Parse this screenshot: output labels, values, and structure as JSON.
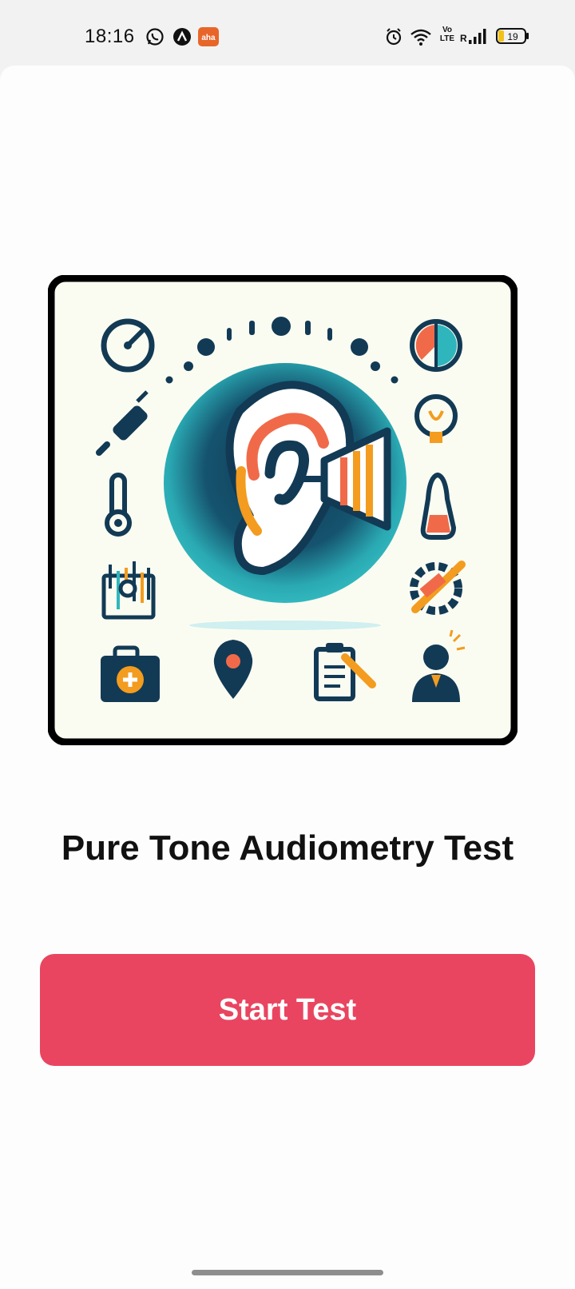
{
  "status_bar": {
    "time": "18:16",
    "battery_level": "19",
    "left_icons": [
      "whatsapp-icon",
      "app-a-icon",
      "aha-app-icon"
    ],
    "right_icons": [
      "alarm-icon",
      "wifi-icon",
      "volte-icon",
      "signal-icon",
      "battery-icon"
    ],
    "volte_label": "Vo LTE",
    "roaming_label": "R",
    "aha_label": "aha"
  },
  "main": {
    "title": "Pure Tone Audiometry Test",
    "start_button_label": "Start Test",
    "illustration_icons": [
      "gauge-icon",
      "pie-chart-icon",
      "plug-icon",
      "lightbulb-icon",
      "thermometer-icon",
      "gauge-tube-icon",
      "equalizer-icon",
      "gear-icon",
      "medical-kit-icon",
      "location-pin-icon",
      "clipboard-icon",
      "person-icon",
      "ear-icon"
    ]
  },
  "colors": {
    "accent": "#e94560",
    "navy": "#123a55",
    "teal": "#2fb6bd",
    "orange": "#f39c1f",
    "coral": "#f06a4a",
    "card_bg": "#fbfcf1"
  }
}
